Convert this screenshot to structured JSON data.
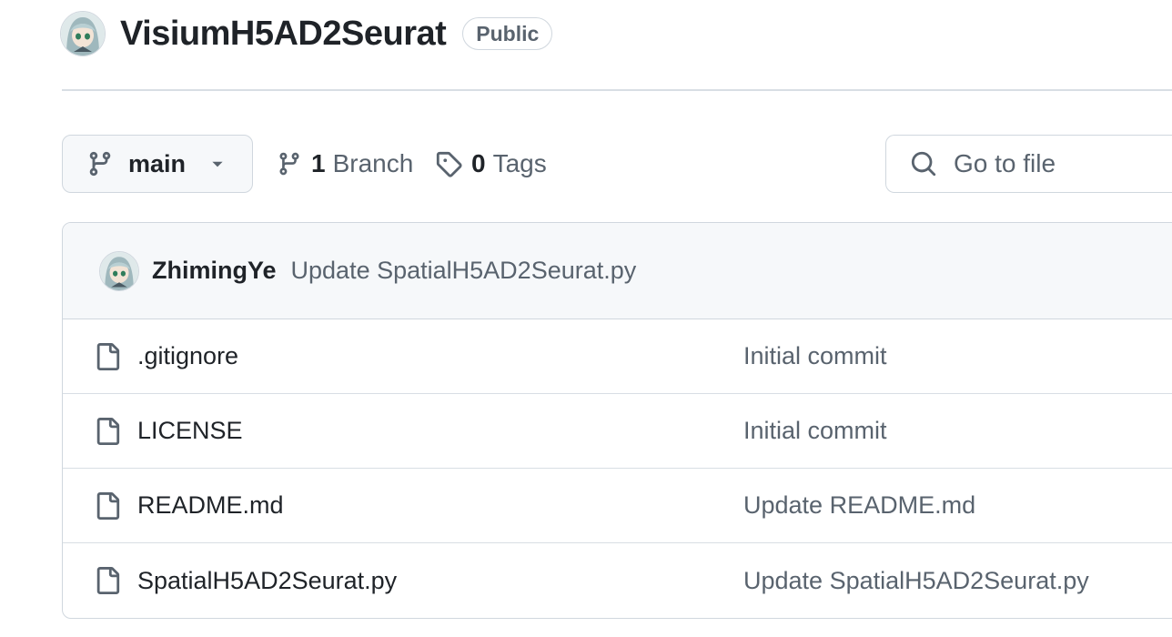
{
  "repo": {
    "name": "VisiumH5AD2Seurat",
    "visibility": "Public",
    "owner_avatar_icon": "anime-avatar-icon"
  },
  "toolbar": {
    "branch": "main",
    "branch_icon": "git-branch-icon",
    "branch_count": "1",
    "branch_label": "Branch",
    "tag_count": "0",
    "tag_label": "Tags",
    "search_placeholder": "Go to file",
    "search_value": ""
  },
  "latest_commit": {
    "author": "ZhimingYe",
    "message": "Update SpatialH5AD2Seurat.py"
  },
  "files": [
    {
      "name": ".gitignore",
      "message": "Initial commit"
    },
    {
      "name": "LICENSE",
      "message": "Initial commit"
    },
    {
      "name": "README.md",
      "message": "Update README.md"
    },
    {
      "name": "SpatialH5AD2Seurat.py",
      "message": "Update SpatialH5AD2Seurat.py"
    }
  ],
  "colors": {
    "text_primary": "#1f2328",
    "text_muted": "#59636e",
    "border": "#d0d7de",
    "header_bg": "#f6f8fa"
  }
}
